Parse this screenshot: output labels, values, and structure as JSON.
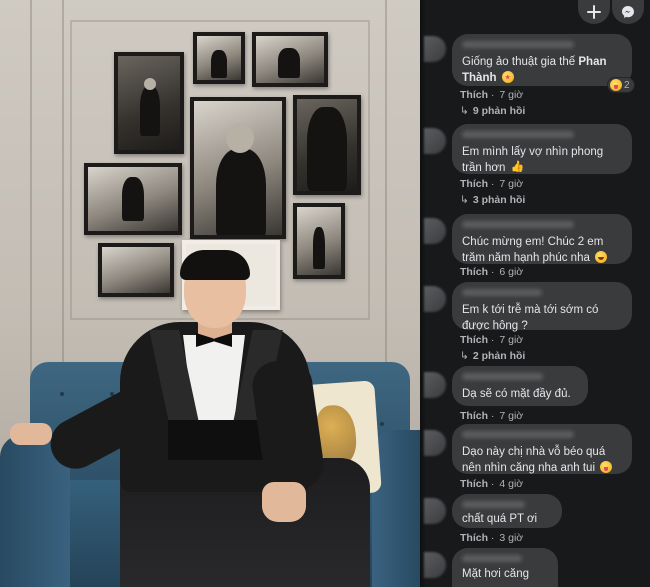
{
  "top_actions": [
    {
      "label": "+"
    },
    {
      "label": "messenger"
    }
  ],
  "comments": [
    {
      "text": "Giống ảo thuật gia thế ",
      "mention": "Phan Thành",
      "emoji": "star-eyes",
      "reaction_count": "2",
      "like_label": "Thích",
      "time": "7 giờ",
      "replies": "9 phản hồi"
    },
    {
      "text": "Em mình lấy vợ nhìn phong trần hơn",
      "emoji": "thumbs-up",
      "like_label": "Thích",
      "time": "7 giờ",
      "replies": "3 phản hồi"
    },
    {
      "text": "Chúc mừng em! Chúc 2 em trăm năm hạnh phúc nha",
      "emoji": "smile",
      "like_label": "Thích",
      "time": "6 giờ"
    },
    {
      "text": "Em k tới trễ mà tới sớm có được hông ?",
      "like_label": "Thích",
      "time": "7 giờ",
      "replies": "2 phản hồi"
    },
    {
      "text": "Dạ sẽ có mặt đầy đủ.",
      "like_label": "Thích",
      "time": "7 giờ"
    },
    {
      "text": "Dạo này chị nhà vỗ béo quá nên nhìn căng nha anh tui",
      "emoji": "tongue",
      "like_label": "Thích",
      "time": "4 giờ"
    },
    {
      "text": "chất quá PT ơi",
      "like_label": "Thích",
      "time": "3 giờ"
    },
    {
      "text": "Mặt hơi căng"
    }
  ],
  "icons": {
    "plus": "plus-icon",
    "messenger": "messenger-icon",
    "reply_arrow": "↳"
  },
  "colors": {
    "panel_bg": "#18191a",
    "bubble_bg": "#3a3b3c",
    "text": "#e4e6eb",
    "muted": "#b0b3b8"
  }
}
